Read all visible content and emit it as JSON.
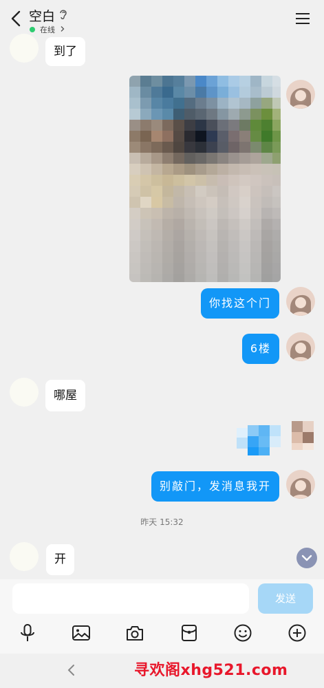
{
  "header": {
    "contact_name": "空白",
    "status": "在线"
  },
  "messages": [
    {
      "side": "left",
      "text": "到了"
    },
    {
      "side": "right",
      "type": "image"
    },
    {
      "side": "right",
      "text": "你找这个门"
    },
    {
      "side": "right",
      "text": "6楼"
    },
    {
      "side": "left",
      "text": "哪屋"
    },
    {
      "side": "right",
      "type": "image"
    },
    {
      "side": "right",
      "text": "别敲门，发消息我开"
    },
    {
      "side": "left",
      "text": "开"
    }
  ],
  "timestamp": "昨天 15:32",
  "composer": {
    "placeholder": "",
    "send_label": "发送"
  },
  "toolbar": [
    "microphone-icon",
    "image-icon",
    "camera-icon",
    "red-packet-icon",
    "emoji-icon",
    "plus-icon"
  ],
  "watermark": "寻欢阁xhg521.com",
  "colors": {
    "accent": "#1297f7",
    "send_disabled": "#a6d7f7",
    "online": "#2ecc71",
    "watermark": "#e8172b"
  }
}
